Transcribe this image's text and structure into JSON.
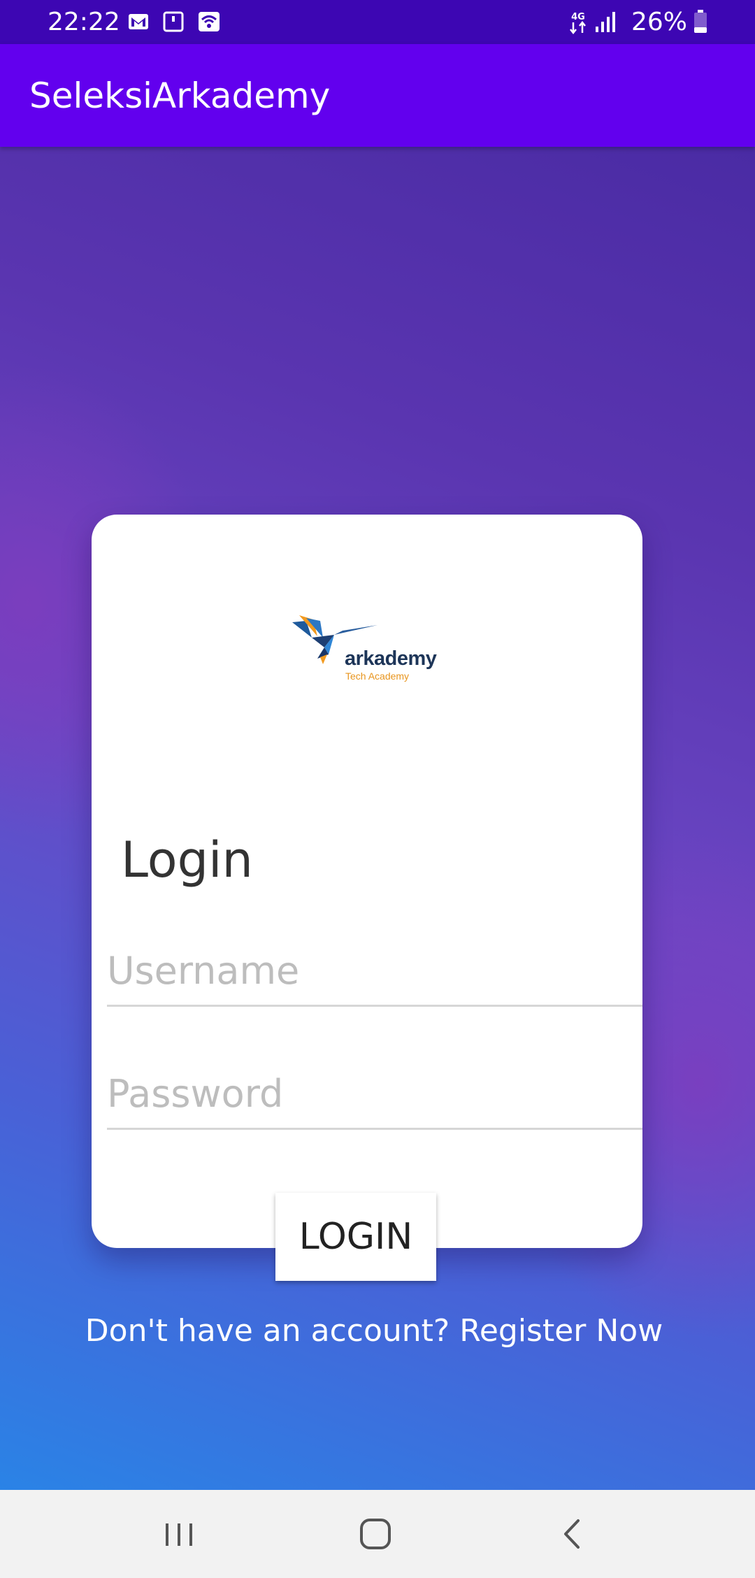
{
  "status_bar": {
    "time": "22:22",
    "network": "4G",
    "battery": "26%",
    "icons": [
      "gmail-icon",
      "notification-icon",
      "wifi-calling-icon",
      "network-4g-icon",
      "signal-icon",
      "battery-icon"
    ]
  },
  "app_bar": {
    "title": "SeleksiArkademy",
    "color": "#6200ee"
  },
  "card": {
    "logo": {
      "wordmark": "arkademy",
      "tagline": "Tech Academy"
    },
    "heading": "Login",
    "username": {
      "placeholder": "Username",
      "value": ""
    },
    "password": {
      "placeholder": "Password",
      "value": ""
    }
  },
  "actions": {
    "login_label": "LOGIN",
    "register_text": "Don't have an account? Register Now"
  },
  "nav_bar": {
    "icons": [
      "recents-icon",
      "home-icon",
      "back-icon"
    ]
  }
}
